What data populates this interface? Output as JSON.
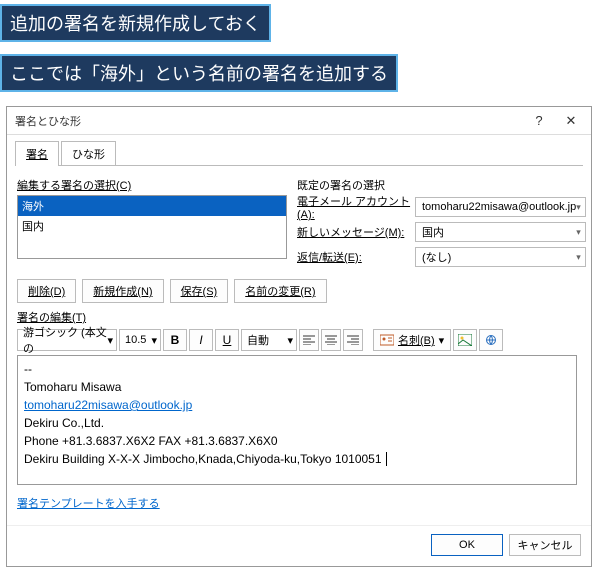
{
  "callouts": {
    "c1": "追加の署名を新規作成しておく",
    "c2": "ここでは「海外」という名前の署名を追加する"
  },
  "dialog": {
    "title": "署名とひな形",
    "help_glyph": "?",
    "close_glyph": "✕"
  },
  "tabs": {
    "sig": "署名",
    "template": "ひな形"
  },
  "left": {
    "select_label": "編集する署名の選択(C)",
    "items": [
      "海外",
      "国内"
    ]
  },
  "right": {
    "section": "既定の署名の選択",
    "account_label": "電子メール アカウント(A):",
    "account_value": "tomoharu22misawa@outlook.jp",
    "newmsg_label": "新しいメッセージ(M):",
    "newmsg_value": "国内",
    "reply_label": "返信/転送(E):",
    "reply_value": "(なし)"
  },
  "buttons": {
    "delete": "削除(D)",
    "new": "新規作成(N)",
    "save": "保存(S)",
    "rename": "名前の変更(R)"
  },
  "edit_label": "署名の編集(T)",
  "toolbar": {
    "font": "游ゴシック (本文の",
    "size": "10.5",
    "bold": "B",
    "italic": "I",
    "underline": "U",
    "color": "自動",
    "bizcard": "名刺(B)"
  },
  "editor": {
    "l1": "--",
    "l2": "Tomoharu Misawa",
    "l3": "tomoharu22misawa@outlook.jp",
    "l4": "Dekiru Co.,Ltd.",
    "l5": "Phone +81.3.6837.X6X2 FAX +81.3.6837.X6X0",
    "l6": "Dekiru Building X-X-X Jimbocho,Knada,Chiyoda-ku,Tokyo 1010051"
  },
  "link_text": "署名テンプレートを入手する",
  "dlg": {
    "ok": "OK",
    "cancel": "キャンセル"
  }
}
